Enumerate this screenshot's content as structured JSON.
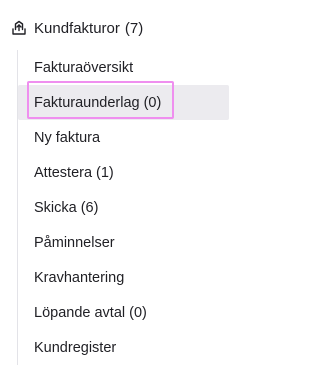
{
  "section": {
    "title": "Kundfakturor",
    "count": "(7)",
    "icon": "invoice-upload-icon"
  },
  "nav": {
    "items": [
      {
        "label": "Fakturaöversikt",
        "count": ""
      },
      {
        "label": "Fakturaunderlag",
        "count": "(0)",
        "active": true
      },
      {
        "label": "Ny faktura",
        "count": ""
      },
      {
        "label": "Attestera",
        "count": "(1)"
      },
      {
        "label": "Skicka",
        "count": "(6)"
      },
      {
        "label": "Påminnelser",
        "count": ""
      },
      {
        "label": "Kravhantering",
        "count": ""
      },
      {
        "label": "Löpande avtal",
        "count": "(0)"
      },
      {
        "label": "Kundregister",
        "count": ""
      }
    ]
  },
  "colors": {
    "active_background": "#ecebef",
    "highlight_border": "#ef8fef",
    "rail": "#e3e3e8",
    "text": "#1f1f24"
  }
}
